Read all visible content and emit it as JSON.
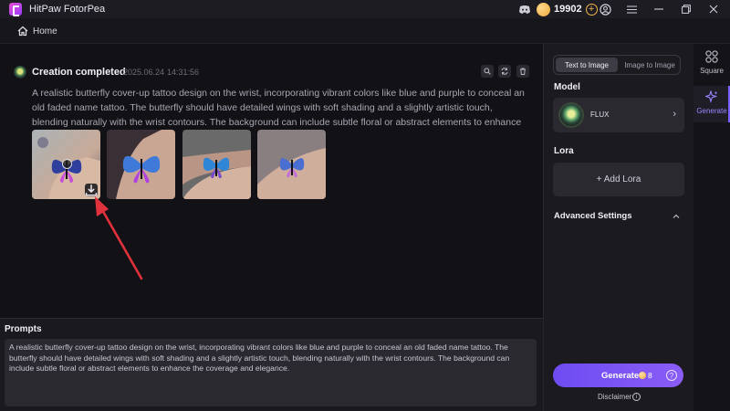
{
  "app": {
    "title": "HitPaw FotorPea",
    "coins": "19902",
    "icons": [
      "discord-icon",
      "coin-icon",
      "add-coins-icon",
      "account-icon",
      "menu-icon",
      "minimize-icon",
      "maximize-icon",
      "close-icon"
    ]
  },
  "nav": {
    "home_label": "Home"
  },
  "creation": {
    "title": "Creation completed",
    "date": "2025.06.24",
    "time": "14:31:56",
    "prompt": "A realistic butterfly cover-up tattoo design on the wrist, incorporating vibrant colors like blue and purple to conceal an old faded name tattoo. The butterfly should have detailed wings with soft shading and a slightly artistic touch, blending naturally with the wrist contours. The background can include subtle floral or abstract elements to enhance the coverage ...",
    "images": [
      {
        "name": "result-image-1",
        "wing": "#2e3f9e",
        "accent": "#c84fd8"
      },
      {
        "name": "result-image-2",
        "wing": "#3f7ad8",
        "accent": "#b040e0"
      },
      {
        "name": "result-image-3",
        "wing": "#2f86d6",
        "accent": "#7a4ad0"
      },
      {
        "name": "result-image-4",
        "wing": "#4a6fd0",
        "accent": "#c070d8"
      }
    ]
  },
  "prompts": {
    "title": "Prompts",
    "text": "A realistic butterfly cover-up tattoo design on the wrist, incorporating vibrant colors like blue and purple to conceal an old faded name tattoo. The butterfly should have detailed wings with soft shading and a slightly artistic touch, blending naturally with the wrist contours. The background can include subtle floral or abstract elements to enhance the coverage and elegance."
  },
  "panel": {
    "tabs": [
      "Text to Image",
      "Image to Image"
    ],
    "model_label": "Model",
    "model_name": "FLUX",
    "lora_label": "Lora",
    "add_lora": "+ Add Lora",
    "advanced_label": "Advanced Settings",
    "generate_label": "Generate",
    "generate_cost": "8",
    "disclaimer": "Disclaimer"
  },
  "rail": {
    "items": [
      {
        "label": "Square",
        "icon": "square-grid-icon"
      },
      {
        "label": "Generate",
        "icon": "sparkle-icon",
        "active": true
      }
    ]
  },
  "colors": {
    "accent": "#7b61ff",
    "arrow": "#e0323c"
  }
}
